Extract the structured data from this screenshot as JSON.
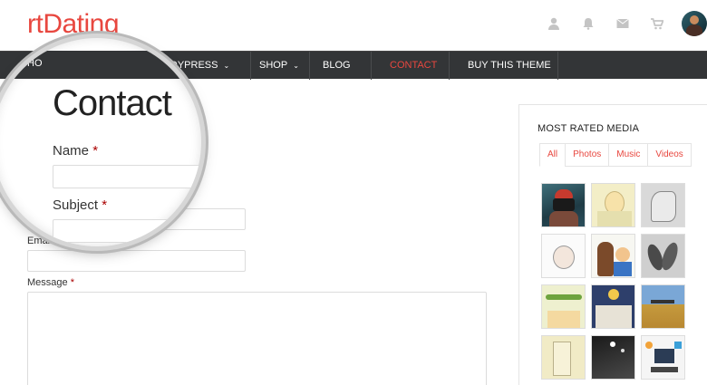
{
  "header": {
    "logo": "rtDating",
    "icons": [
      "user-icon",
      "bell-icon",
      "mail-icon",
      "cart-icon"
    ]
  },
  "nav": {
    "items": [
      {
        "label": "HOME",
        "visible": "HO"
      },
      {
        "label": "BUDDYPRESS",
        "visible": "UDDYPRESS",
        "chevron": "⌄"
      },
      {
        "label": "SHOP",
        "chevron": "⌄"
      },
      {
        "label": "BLOG"
      },
      {
        "label": "CONTACT",
        "active": true
      },
      {
        "label": "BUY THIS THEME"
      }
    ]
  },
  "page": {
    "title": "Contact"
  },
  "form": {
    "name_label": "Name",
    "subject_label": "Subject",
    "email_label": "Email",
    "message_label": "Message",
    "required_mark": "*"
  },
  "widget": {
    "title": "MOST RATED MEDIA",
    "tabs": [
      "All",
      "Photos",
      "Music",
      "Videos"
    ],
    "active_tab": "All",
    "thumbnails": [
      "photographer-thumbnail",
      "girl-drawing-thumbnail",
      "sketch-thumbnail",
      "baby-sketch-thumbnail",
      "drum-kid-thumbnail",
      "feathers-thumbnail",
      "nursery-thumbnail",
      "baby-room-thumbnail",
      "savanna-thumbnail",
      "hallway-thumbnail",
      "dark-artwork-thumbnail",
      "workspace-thumbnail"
    ]
  },
  "colors": {
    "accent": "#e8473f",
    "nav_bg": "#333537"
  }
}
